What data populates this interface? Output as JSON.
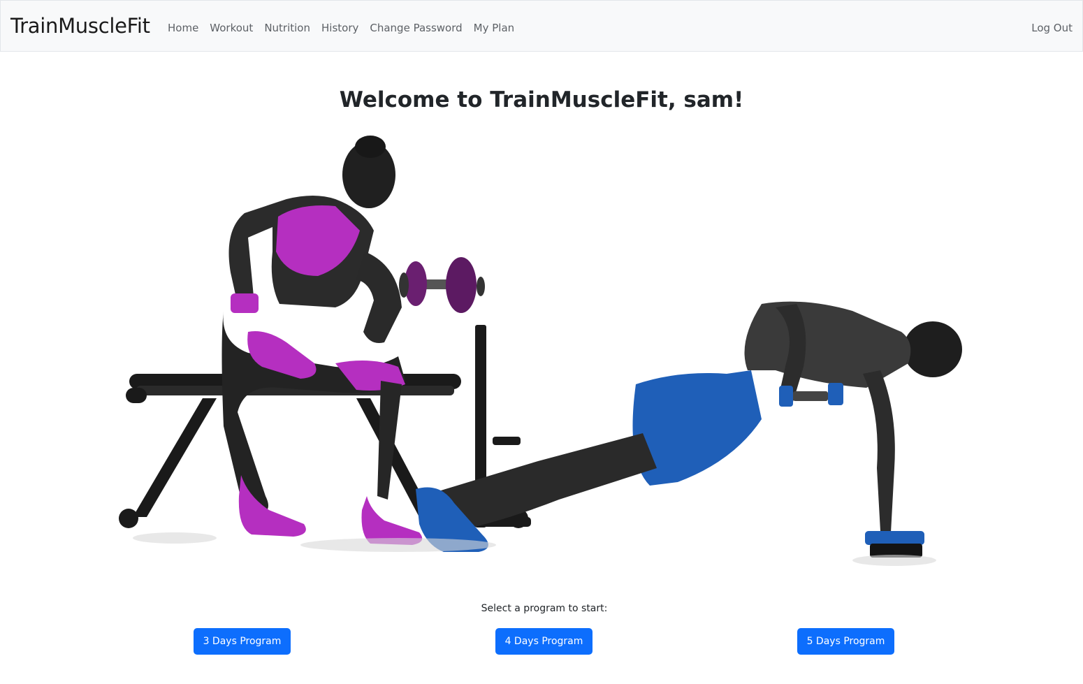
{
  "navbar": {
    "brand": "TrainMuscleFit",
    "links": [
      {
        "label": "Home"
      },
      {
        "label": "Workout"
      },
      {
        "label": "Nutrition"
      },
      {
        "label": "History"
      },
      {
        "label": "Change Password"
      },
      {
        "label": "My Plan"
      }
    ],
    "logout_label": "Log Out"
  },
  "main": {
    "welcome_title": "Welcome to TrainMuscleFit, sam!",
    "program_prompt": "Select a program to start:",
    "programs": [
      {
        "label": "3 Days Program"
      },
      {
        "label": "4 Days Program"
      },
      {
        "label": "5 Days Program"
      }
    ]
  },
  "colors": {
    "primary_button": "#0d6efd",
    "navbar_bg": "#f8f9fa",
    "accent_pink": "#c43ad0",
    "accent_blue": "#1f5fb8"
  }
}
